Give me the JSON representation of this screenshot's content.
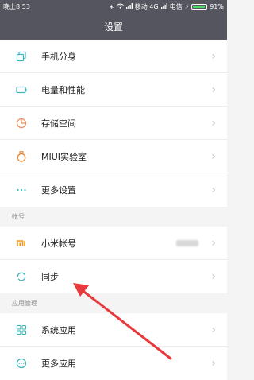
{
  "status_bar": {
    "time": "晚上8:53",
    "bluetooth": "∗",
    "network": "移动 4G",
    "carrier2": "电信",
    "battery": "91%"
  },
  "header": {
    "title": "设置"
  },
  "group1": [
    {
      "label": "手机分身",
      "icon": "clone-icon"
    },
    {
      "label": "电量和性能",
      "icon": "battery-icon"
    },
    {
      "label": "存储空间",
      "icon": "storage-pie-icon"
    },
    {
      "label": "MIUI实验室",
      "icon": "lab-flask-icon"
    },
    {
      "label": "更多设置",
      "icon": "more-dots-icon"
    }
  ],
  "section_account": {
    "title": "帐号"
  },
  "group2": [
    {
      "label": "小米帐号",
      "icon": "mi-logo-icon"
    },
    {
      "label": "同步",
      "icon": "sync-icon"
    }
  ],
  "section_apps": {
    "title": "应用管理"
  },
  "group3": [
    {
      "label": "系统应用",
      "icon": "apps-grid-icon"
    },
    {
      "label": "更多应用",
      "icon": "more-apps-icon"
    }
  ],
  "colors": {
    "bar": "#55555f",
    "icon": "#3cb4b8",
    "storage": "#f08a5d",
    "mi": "#f29c1f",
    "arrow": "#e8393d"
  }
}
